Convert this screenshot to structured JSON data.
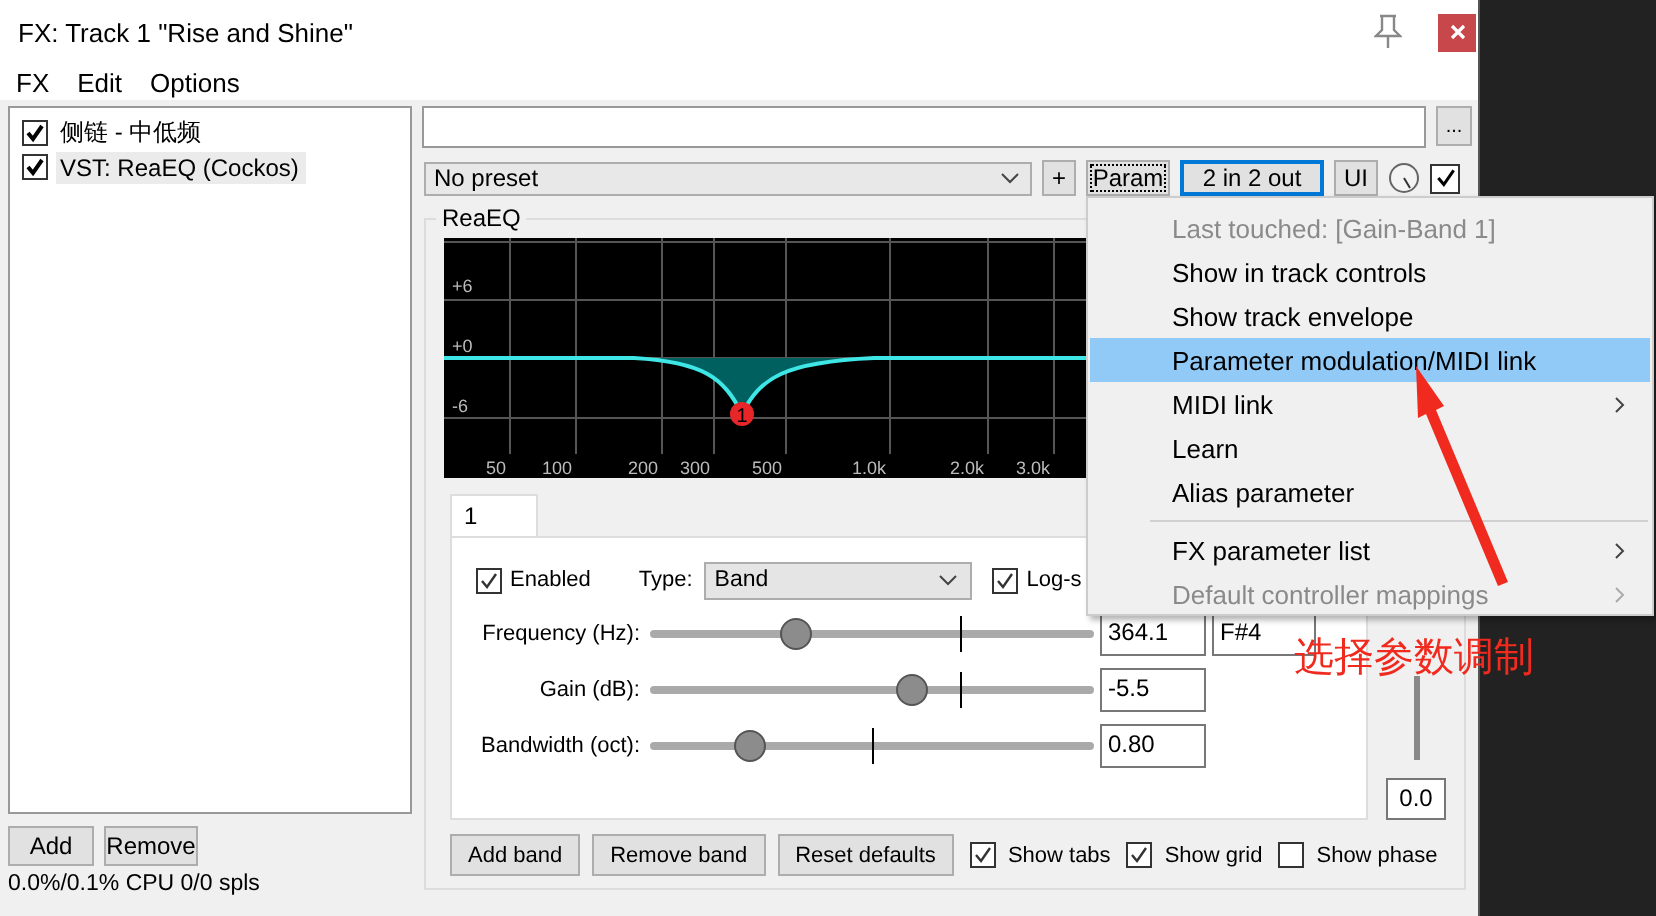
{
  "window": {
    "title": "FX: Track 1 \"Rise and Shine\""
  },
  "menu_bar": [
    "FX",
    "Edit",
    "Options"
  ],
  "fx_list": [
    {
      "name": "侧链 - 中低频",
      "checked": true,
      "selected": false
    },
    {
      "name": "VST: ReaEQ (Cockos)",
      "checked": true,
      "selected": true
    }
  ],
  "list_buttons": [
    "Add",
    "Remove"
  ],
  "cpu": "0.0%/0.1% CPU 0/0 spls",
  "toolbar": {
    "more": "...",
    "preset": "No preset",
    "plus": "+",
    "param": "Param",
    "io": "2 in 2 out",
    "ui": "UI",
    "enabled_checked": true
  },
  "plugin": {
    "title": "ReaEQ",
    "graph": {
      "y_labels": [
        "+6",
        "+0",
        "-6"
      ],
      "x_labels": [
        "50",
        "100",
        "200",
        "300",
        "500",
        "1.0k",
        "2.0k",
        "3.0k"
      ],
      "node": "1"
    },
    "tabs": [
      {
        "label": "1",
        "selected": true
      }
    ],
    "enabled": {
      "label": "Enabled",
      "checked": true
    },
    "type_label": "Type:",
    "type": "Band",
    "log": {
      "label": "Log-s",
      "checked": true
    },
    "params": [
      {
        "label": "Frequency (Hz):",
        "level": 0.33,
        "value": "364.1",
        "note": "F#4"
      },
      {
        "label": "Gain (dB):",
        "level": 0.59,
        "value": "-5.5"
      },
      {
        "label": "Bandwidth (oct):",
        "level": 0.225,
        "value": "0.80"
      }
    ],
    "output_value": "0.0",
    "buttons": [
      "Add band",
      "Remove band",
      "Reset defaults"
    ],
    "options": [
      {
        "label": "Show tabs",
        "checked": true
      },
      {
        "label": "Show grid",
        "checked": true
      },
      {
        "label": "Show phase",
        "checked": false
      }
    ]
  },
  "context_menu": [
    {
      "kind": "item",
      "label": "Last touched: [Gain-Band 1]",
      "disabled": true,
      "selected": false,
      "submenu": false
    },
    {
      "kind": "item",
      "label": "Show in track controls",
      "disabled": false,
      "selected": false,
      "submenu": false
    },
    {
      "kind": "item",
      "label": "Show track envelope",
      "disabled": false,
      "selected": false,
      "submenu": false
    },
    {
      "kind": "item",
      "label": "Parameter modulation/MIDI link",
      "disabled": false,
      "selected": true,
      "submenu": false
    },
    {
      "kind": "item",
      "label": "MIDI link",
      "disabled": false,
      "selected": false,
      "submenu": true
    },
    {
      "kind": "item",
      "label": "Learn",
      "disabled": false,
      "selected": false,
      "submenu": false
    },
    {
      "kind": "item",
      "label": "Alias parameter",
      "disabled": false,
      "selected": false,
      "submenu": false
    },
    {
      "kind": "separator"
    },
    {
      "kind": "item",
      "label": "FX parameter list",
      "disabled": false,
      "selected": false,
      "submenu": true
    },
    {
      "kind": "item",
      "label": "Default controller mappings",
      "disabled": true,
      "selected": false,
      "submenu": true
    }
  ],
  "annotation": {
    "text": "选择参数调制"
  }
}
